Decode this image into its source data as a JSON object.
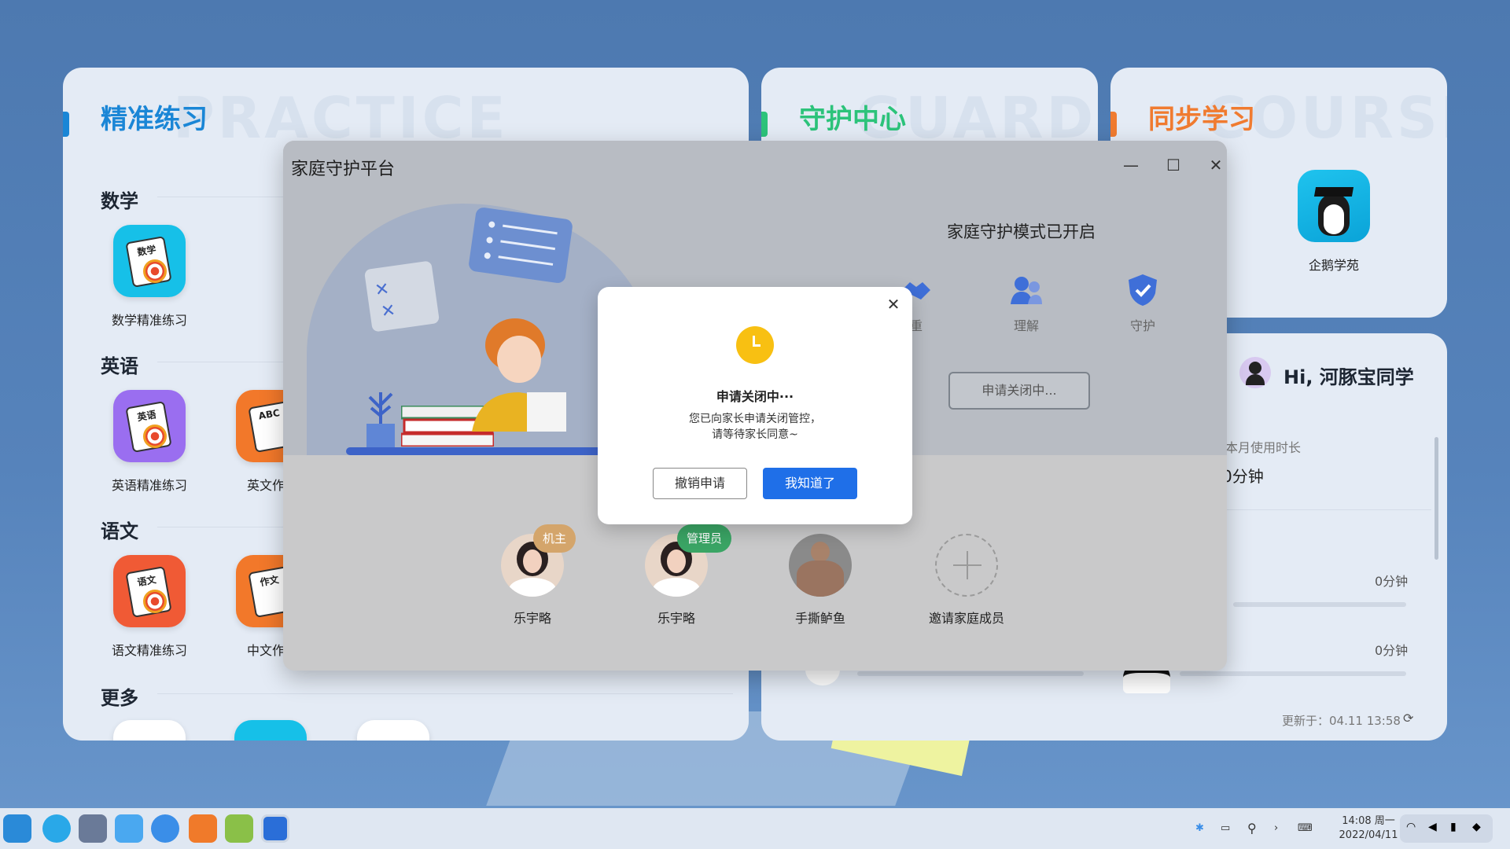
{
  "practice_card": {
    "title": "精准练习",
    "title_bg": "PRACTICE",
    "sections": [
      {
        "label": "数学",
        "apps": [
          {
            "label": "数学精准练习",
            "icon_text": "数学"
          }
        ]
      },
      {
        "label": "英语",
        "apps": [
          {
            "label": "英语精准练习",
            "icon_text": "英语"
          },
          {
            "label": "英文作文",
            "icon_text": "ABC"
          }
        ]
      },
      {
        "label": "语文",
        "apps": [
          {
            "label": "语文精准练习",
            "icon_text": "语文"
          },
          {
            "label": "中文作文",
            "icon_text": "作文"
          }
        ]
      },
      {
        "label": "更多",
        "apps": []
      }
    ]
  },
  "guard_card": {
    "title": "守护中心",
    "title_bg": "GUARDS"
  },
  "sync_card": {
    "title": "同步学习",
    "title_bg": "COURSE",
    "app_label": "企鹅学苑"
  },
  "stats_card": {
    "greeting": "Hi, 河豚宝同学",
    "usage_label": "本月使用时长",
    "usage_value": "0分钟",
    "row1_value": "0分钟",
    "row2_value": "0分钟",
    "updated": "更新于：04.11 13:58"
  },
  "window": {
    "title": "家庭守护平台",
    "mode_title": "家庭守护模式已开启",
    "mode_items": [
      {
        "label": "重",
        "icon": "handshake-icon"
      },
      {
        "label": "理解",
        "icon": "people-icon"
      },
      {
        "label": "守护",
        "icon": "shield-icon"
      }
    ],
    "apply_button": "申请关闭中...",
    "members": [
      {
        "name": "乐宇略",
        "badge": "机主",
        "badge_color": "#d4a56b"
      },
      {
        "name": "乐宇略",
        "badge": "管理员",
        "badge_color": "#3aa565"
      },
      {
        "name": "手撕鲈鱼",
        "badge": ""
      },
      {
        "name": "邀请家庭成员",
        "badge": ""
      }
    ]
  },
  "dialog": {
    "title": "申请关闭中···",
    "message_line1": "您已向家长申请关闭管控，",
    "message_line2": "请等待家长同意~",
    "cancel_label": "撤销申请",
    "ok_label": "我知道了"
  },
  "taskbar": {
    "time": "14:08 周一",
    "date": "2022/04/11"
  },
  "colors": {
    "practice_accent": "#1a86d6",
    "guard_accent": "#2cc37a",
    "sync_accent": "#f07b30",
    "primary_button": "#1f6fe8"
  }
}
